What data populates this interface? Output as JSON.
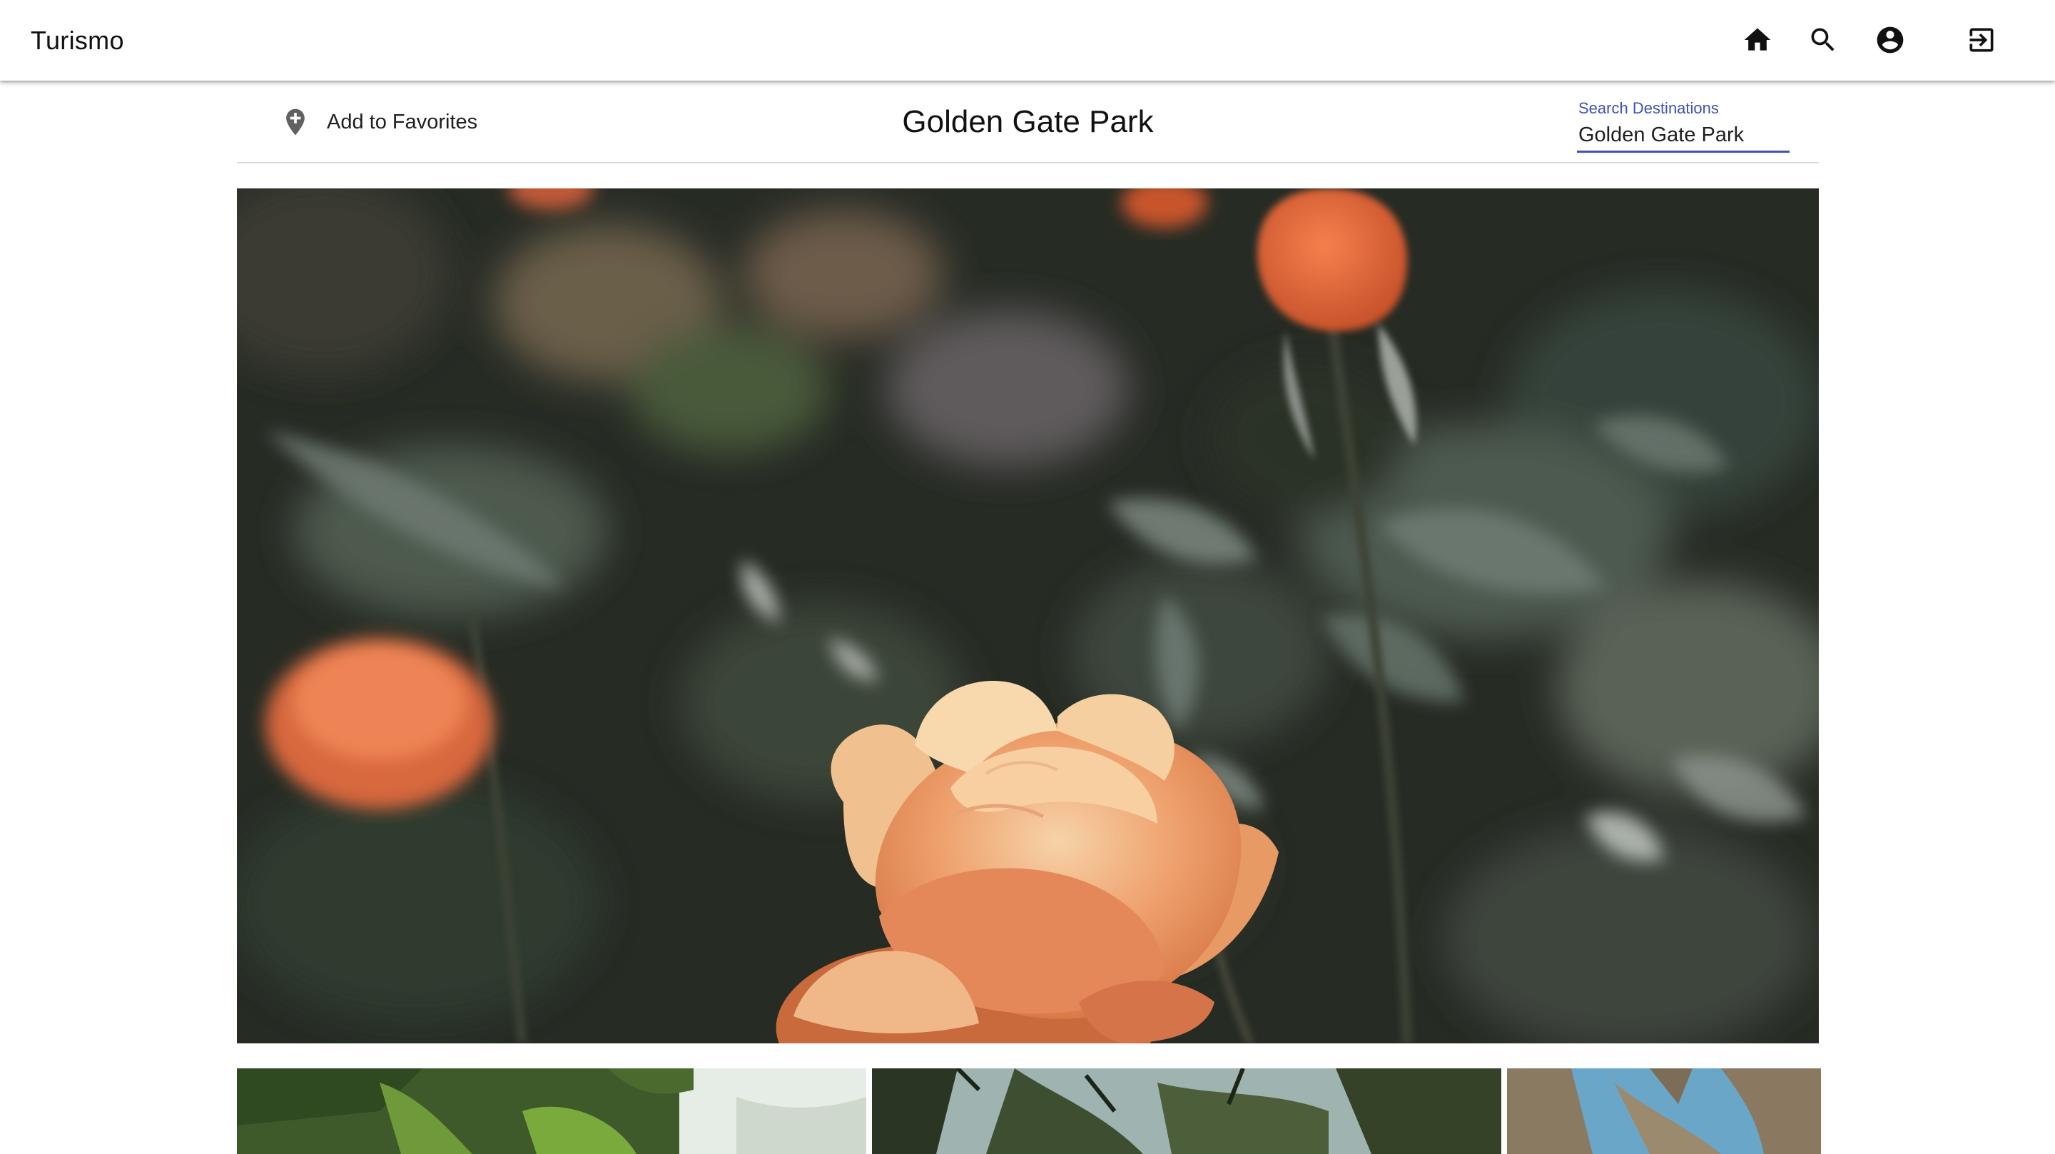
{
  "app": {
    "title": "Turismo"
  },
  "nav": {
    "icons": [
      "home-icon",
      "search-icon",
      "account-circle-icon",
      "logout-icon"
    ]
  },
  "destination": {
    "title": "Golden Gate Park",
    "favorite_label": "Add to Favorites",
    "favorite_icon": "add-location-icon"
  },
  "search": {
    "label": "Search Destinations",
    "value": "Golden Gate Park"
  },
  "colors": {
    "accent": "#3f51b5",
    "icon": "#111111",
    "pin": "#616161"
  }
}
